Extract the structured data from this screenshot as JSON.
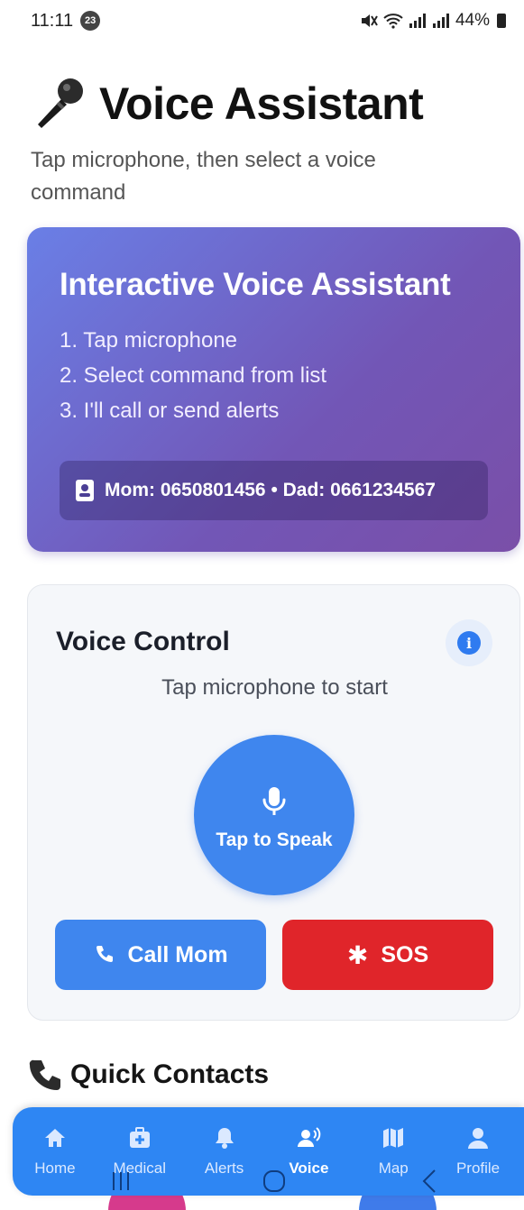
{
  "status_bar": {
    "time": "11:11",
    "notification_count": "23",
    "battery": "44%"
  },
  "header": {
    "title": "Voice Assistant",
    "subtitle": "Tap microphone, then select a voice command"
  },
  "info_card": {
    "title": "Interactive Voice Assistant",
    "steps": [
      "1. Tap microphone",
      "2. Select command from list",
      "3. I'll call or send alerts"
    ],
    "contacts": "Mom: 0650801456 • Dad: 0661234567"
  },
  "voice_control": {
    "title": "Voice Control",
    "hint": "Tap microphone to start",
    "speak_label": "Tap to Speak",
    "call_label": "Call Mom",
    "sos_label": "SOS"
  },
  "quick_contacts": {
    "title": "Quick Contacts"
  },
  "bottom_nav": {
    "items": [
      {
        "label": "Home",
        "icon": "home-icon"
      },
      {
        "label": "Medical",
        "icon": "medical-kit-icon"
      },
      {
        "label": "Alerts",
        "icon": "bell-icon"
      },
      {
        "label": "Voice",
        "icon": "voice-person-icon"
      },
      {
        "label": "Map",
        "icon": "map-icon"
      },
      {
        "label": "Profile",
        "icon": "person-icon"
      }
    ],
    "active": "Voice"
  },
  "colors": {
    "primary_blue": "#3f86ee",
    "nav_blue": "#2e86f3",
    "sos_red": "#e0252a",
    "card_gradient_start": "#6a7fe6",
    "card_gradient_end": "#7a4fa8"
  }
}
